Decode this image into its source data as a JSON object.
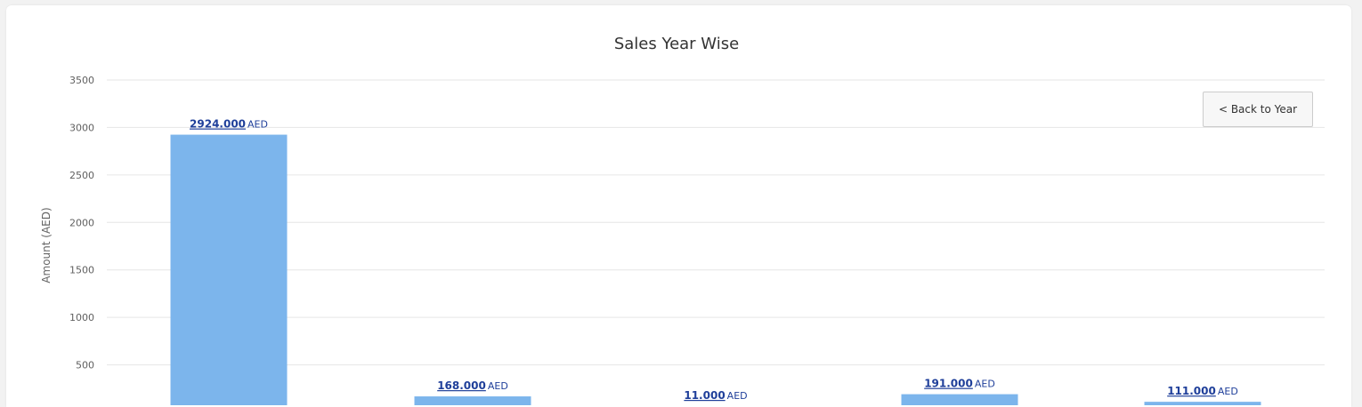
{
  "chart_data": {
    "type": "bar",
    "title": "Sales Year Wise",
    "xlabel": "",
    "ylabel": "Amount (AED)",
    "ylim": [
      0,
      3500
    ],
    "yticks": [
      500,
      1000,
      1500,
      2000,
      2500,
      3000,
      3500
    ],
    "grid": true,
    "categories": [
      "",
      "",
      "",
      "",
      ""
    ],
    "values": [
      2924,
      168,
      11,
      191,
      111
    ],
    "data_labels": [
      "2924.000",
      "168.000",
      "11.000",
      "191.000",
      "111.000"
    ],
    "data_label_unit": "AED",
    "bar_color": "#7cb5ec",
    "label_color": "#1f3f9a"
  },
  "controls": {
    "back_button_label": "< Back to Year"
  }
}
